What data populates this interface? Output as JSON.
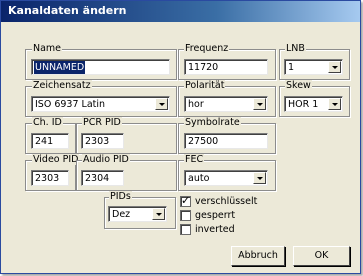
{
  "window": {
    "title": "Kanaldaten ändern"
  },
  "name": {
    "label": "Name",
    "value": "UNNAMED"
  },
  "frequenz": {
    "label": "Frequenz",
    "value": "11720"
  },
  "lnb": {
    "label": "LNB",
    "value": "1"
  },
  "zeichensatz": {
    "label": "Zeichensatz",
    "value": "ISO 6937 Latin"
  },
  "polaritaet": {
    "label": "Polarität",
    "value": "hor"
  },
  "skew": {
    "label": "Skew",
    "value": "HOR 1"
  },
  "ch_id": {
    "label": "Ch. ID",
    "value": "241"
  },
  "pcr_pid": {
    "label": "PCR PID",
    "value": "2303"
  },
  "symbolrate": {
    "label": "Symbolrate",
    "value": "27500"
  },
  "video_pid": {
    "label": "Video PID",
    "value": "2303"
  },
  "audio_pid": {
    "label": "Audio PID",
    "value": "2304"
  },
  "fec": {
    "label": "FEC",
    "value": "auto"
  },
  "pids": {
    "label": "PIDs",
    "value": "Dez"
  },
  "checks": {
    "verschluesselt": {
      "label": "verschlüsselt",
      "checked": true
    },
    "gesperrt": {
      "label": "gesperrt",
      "checked": false
    },
    "inverted": {
      "label": "inverted",
      "checked": false
    }
  },
  "buttons": {
    "abbruch": "Abbruch",
    "ok": "OK"
  }
}
